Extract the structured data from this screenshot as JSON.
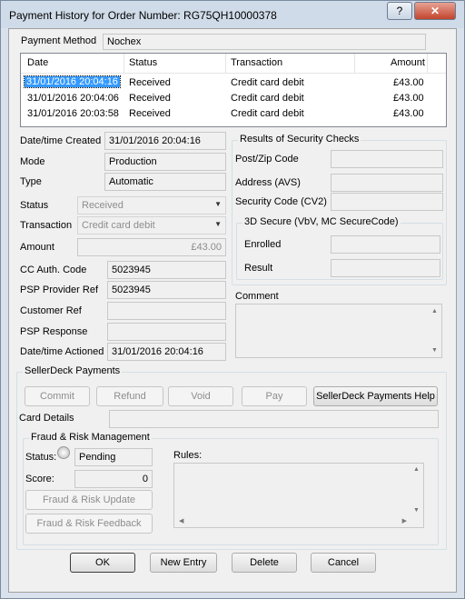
{
  "window": {
    "title": "Payment History for Order Number: RG75QH10000378",
    "help_label": "?",
    "close_label": "✕"
  },
  "payment_method": {
    "label": "Payment Method",
    "value": "Nochex"
  },
  "history": {
    "columns": [
      "Date",
      "Status",
      "Transaction",
      "Amount"
    ],
    "rows": [
      {
        "date": "31/01/2016 20:04:16",
        "status": "Received",
        "transaction": "Credit card debit",
        "amount": "£43.00",
        "selected": true
      },
      {
        "date": "31/01/2016 20:04:06",
        "status": "Received",
        "transaction": "Credit card debit",
        "amount": "£43.00"
      },
      {
        "date": "31/01/2016 20:03:58",
        "status": "Received",
        "transaction": "Credit card debit",
        "amount": "£43.00"
      }
    ]
  },
  "details": {
    "created_label": "Date/time Created",
    "created_value": "31/01/2016 20:04:16",
    "mode_label": "Mode",
    "mode_value": "Production",
    "type_label": "Type",
    "type_value": "Automatic",
    "status_label": "Status",
    "status_value": "Received",
    "transaction_label": "Transaction",
    "transaction_value": "Credit card debit",
    "amount_label": "Amount",
    "amount_value": "£43.00",
    "cc_auth_label": "CC Auth. Code",
    "cc_auth_value": "5023945",
    "psp_ref_label": "PSP Provider Ref",
    "psp_ref_value": "5023945",
    "customer_ref_label": "Customer Ref",
    "customer_ref_value": "",
    "psp_response_label": "PSP Response",
    "psp_response_value": "",
    "actioned_label": "Date/time Actioned",
    "actioned_value": "31/01/2016 20:04:16"
  },
  "security": {
    "title": "Results of Security Checks",
    "postzip_label": "Post/Zip Code",
    "address_label": "Address (AVS)",
    "security_code_label": "Security Code (CV2)",
    "secure3d_title": "3D Secure (VbV, MC SecureCode)",
    "enrolled_label": "Enrolled",
    "result_label": "Result"
  },
  "comment": {
    "label": "Comment"
  },
  "sellerdeck": {
    "title": "SellerDeck Payments",
    "commit_label": "Commit",
    "refund_label": "Refund",
    "void_label": "Void",
    "pay_label": "Pay",
    "help_label": "SellerDeck Payments Help",
    "card_details_label": "Card Details"
  },
  "fraud": {
    "title": "Fraud & Risk Management",
    "status_label": "Status:",
    "status_value": "Pending",
    "score_label": "Score:",
    "score_value": "0",
    "update_label": "Fraud & Risk Update",
    "feedback_label": "Fraud & Risk Feedback",
    "rules_label": "Rules:"
  },
  "buttons": {
    "ok": "OK",
    "new_entry": "New Entry",
    "delete": "Delete",
    "cancel": "Cancel"
  }
}
